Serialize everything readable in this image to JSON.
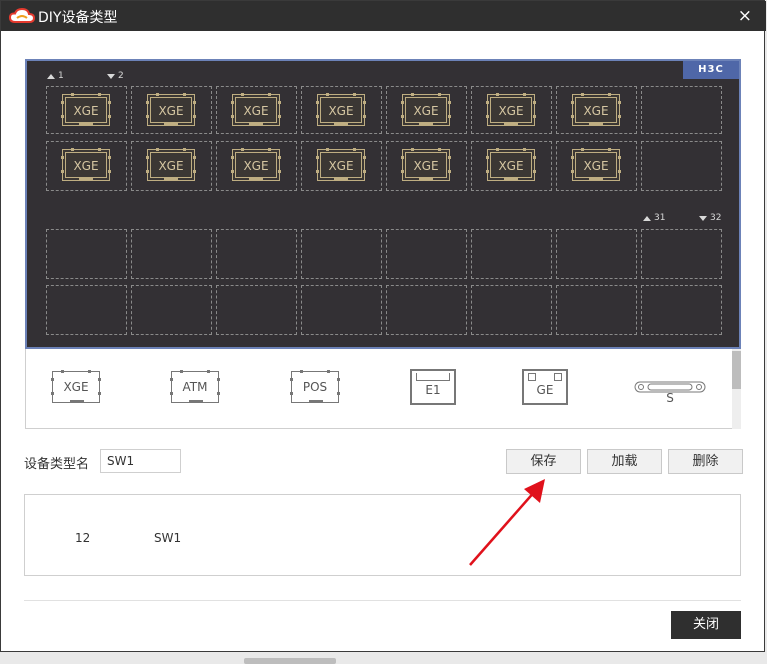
{
  "window": {
    "title": "DIY设备类型",
    "close_symbol": "×"
  },
  "panel": {
    "brand": "H3C",
    "port_labels": {
      "top_left_1": "1",
      "top_left_2": "2",
      "bottom_right_31": "31",
      "bottom_right_32": "32"
    },
    "upper_modules": [
      "XGE",
      "XGE",
      "XGE",
      "XGE",
      "XGE",
      "XGE",
      "XGE",
      "XGE",
      "XGE",
      "XGE",
      "XGE",
      "XGE",
      "XGE",
      "XGE"
    ]
  },
  "palette": {
    "items": [
      {
        "label": "XGE",
        "icon": "module-icon"
      },
      {
        "label": "ATM",
        "icon": "module-icon"
      },
      {
        "label": "POS",
        "icon": "module-icon"
      },
      {
        "label": "E1",
        "icon": "port-icon"
      },
      {
        "label": "GE",
        "icon": "port-icon"
      },
      {
        "label": "S",
        "icon": "serial-connector-icon"
      }
    ]
  },
  "form": {
    "name_label": "设备类型名",
    "name_value": "SW1"
  },
  "buttons": {
    "save": "保存",
    "load": "加载",
    "delete": "删除",
    "close": "关闭"
  },
  "list": {
    "rows": [
      {
        "id": "12",
        "name": "SW1"
      }
    ]
  },
  "colors": {
    "panel_bg": "#333034",
    "module_gold": "#bfae82",
    "brand_blue": "#4f67a8",
    "arrow_red": "#e0111b",
    "titlebar": "#2f2f2f"
  }
}
